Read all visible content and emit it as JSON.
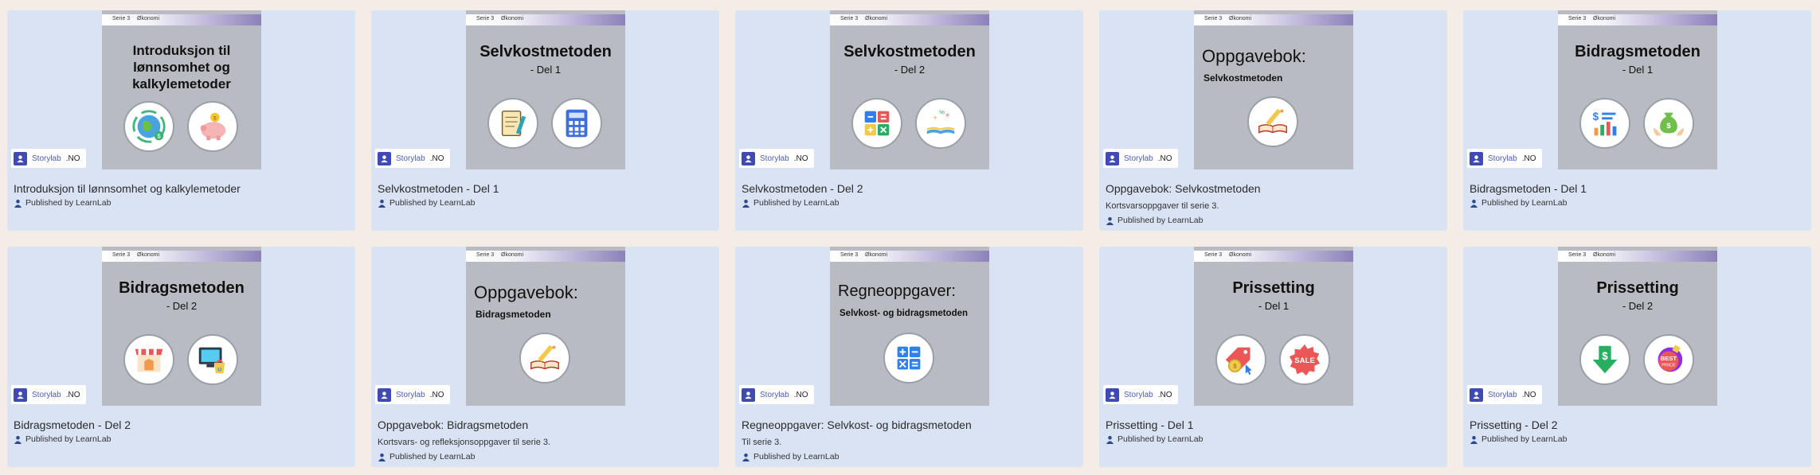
{
  "brand": {
    "name": "Storylab",
    "suffix": ".NO"
  },
  "published_prefix": "Published by LearnLab",
  "cards": [
    {
      "band": [
        "Serie 3",
        "Økonomi"
      ],
      "title_lines": [
        "Introduksjon til",
        "lønnsomhet og",
        "kalkylemetoder"
      ],
      "subtitle": "",
      "icons": [
        "global-economy-icon",
        "piggy-bank-icon"
      ],
      "card_title": "Introduksjon til lønnsomhet og kalkylemetoder",
      "card_desc": "",
      "published": "Published by LearnLab"
    },
    {
      "band": [
        "Serie 3",
        "Økonomi"
      ],
      "title": "Selvkostmetoden",
      "subtitle": "- Del 1",
      "icons": [
        "notebook-pencil-icon",
        "calculator-icon"
      ],
      "card_title": "Selvkostmetoden - Del 1",
      "card_desc": "",
      "published": "Published by LearnLab"
    },
    {
      "band": [
        "Serie 3",
        "Økonomi"
      ],
      "title": "Selvkostmetoden",
      "subtitle": "- Del 2",
      "icons": [
        "math-operators-icon",
        "book-symbols-icon"
      ],
      "card_title": "Selvkostmetoden - Del 2",
      "card_desc": "",
      "published": "Published by LearnLab"
    },
    {
      "band": [
        "Serie 3",
        "Økonomi"
      ],
      "heading": "Oppgavebok:",
      "subheading": "Selvkostmetoden",
      "icons": [
        "book-pencil-icon"
      ],
      "card_title": "Oppgavebok: Selvkostmetoden",
      "card_desc": "Kortsvarsoppgaver til serie 3.",
      "published": "Published by LearnLab"
    },
    {
      "band": [
        "Serie 3",
        "Økonomi"
      ],
      "title": "Bidragsmetoden",
      "subtitle": "- Del 1",
      "icons": [
        "dollar-chart-icon",
        "money-hands-icon"
      ],
      "card_title": "Bidragsmetoden - Del 1",
      "card_desc": "",
      "published": "Published by LearnLab"
    },
    {
      "band": [
        "Serie 3",
        "Økonomi"
      ],
      "title": "Bidragsmetoden",
      "subtitle": "- Del 2",
      "icons": [
        "shop-stall-icon",
        "online-shop-icon"
      ],
      "card_title": "Bidragsmetoden - Del 2",
      "card_desc": "",
      "published": "Published by LearnLab"
    },
    {
      "band": [
        "Serie 3",
        "Økonomi"
      ],
      "heading": "Oppgavebok:",
      "subheading": "Bidragsmetoden",
      "icons": [
        "book-pencil-icon"
      ],
      "card_title": "Oppgavebok: Bidragsmetoden",
      "card_desc": "Kortsvars- og refleksjonsoppgaver til serie 3.",
      "published": "Published by LearnLab"
    },
    {
      "band": [
        "Serie 3",
        "Økonomi"
      ],
      "heading": "Regneoppgaver:",
      "subheading": "Selvkost- og bidragsmetoden",
      "icons": [
        "math-operators-icon"
      ],
      "card_title": "Regneoppgaver: Selvkost- og bidragsmetoden",
      "card_desc": "Til serie 3.",
      "published": "Published by LearnLab"
    },
    {
      "band": [
        "Serie 3",
        "Økonomi"
      ],
      "title": "Prissetting",
      "subtitle": "- Del 1",
      "icons": [
        "price-tag-icon",
        "sale-badge-icon"
      ],
      "card_title": "Prissetting - Del 1",
      "card_desc": "",
      "published": "Published by LearnLab"
    },
    {
      "band": [
        "Serie 3",
        "Økonomi"
      ],
      "title": "Prissetting",
      "subtitle": "- Del 2",
      "icons": [
        "dollar-down-arrow-icon",
        "best-price-tag-icon"
      ],
      "card_title": "Prissetting - Del 2",
      "card_desc": "",
      "published": "Published by LearnLab"
    }
  ]
}
